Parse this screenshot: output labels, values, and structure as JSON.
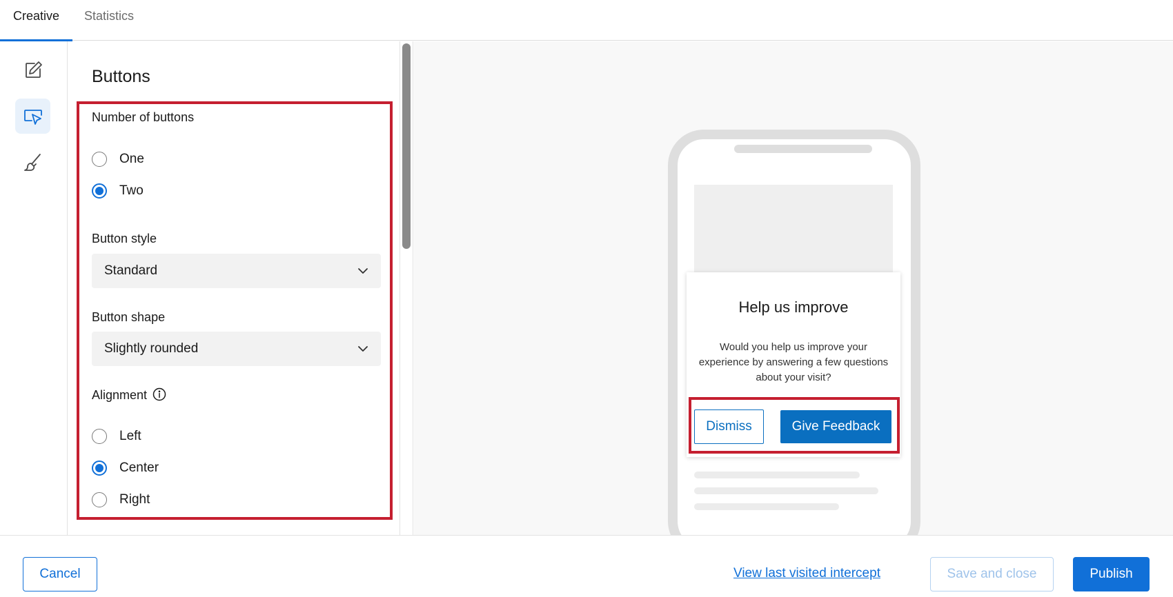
{
  "tabs": [
    {
      "label": "Creative",
      "active": true
    },
    {
      "label": "Statistics",
      "active": false
    }
  ],
  "rail": {
    "items": [
      {
        "icon": "edit-icon",
        "active": false
      },
      {
        "icon": "pointer-click-icon",
        "active": true
      },
      {
        "icon": "brush-icon",
        "active": false
      }
    ]
  },
  "panel": {
    "title": "Buttons",
    "number_of_buttons": {
      "label": "Number of buttons",
      "options": [
        {
          "label": "One",
          "checked": false
        },
        {
          "label": "Two",
          "checked": true
        }
      ]
    },
    "button_style": {
      "label": "Button style",
      "value": "Standard"
    },
    "button_shape": {
      "label": "Button shape",
      "value": "Slightly rounded"
    },
    "alignment": {
      "label": "Alignment",
      "info_icon": "info-icon",
      "options": [
        {
          "label": "Left",
          "checked": false
        },
        {
          "label": "Center",
          "checked": true
        },
        {
          "label": "Right",
          "checked": false
        }
      ]
    }
  },
  "preview": {
    "popup_title": "Help us improve",
    "popup_body": "Would you help us improve your experience by answering a few questions about your visit?",
    "dismiss_label": "Dismiss",
    "feedback_label": "Give Feedback"
  },
  "footer": {
    "cancel_label": "Cancel",
    "view_link": "View last visited intercept",
    "save_label": "Save and close",
    "publish_label": "Publish"
  },
  "colors": {
    "accent": "#1170d8",
    "highlight": "#c51f30",
    "preview_button": "#0a6fc0"
  }
}
